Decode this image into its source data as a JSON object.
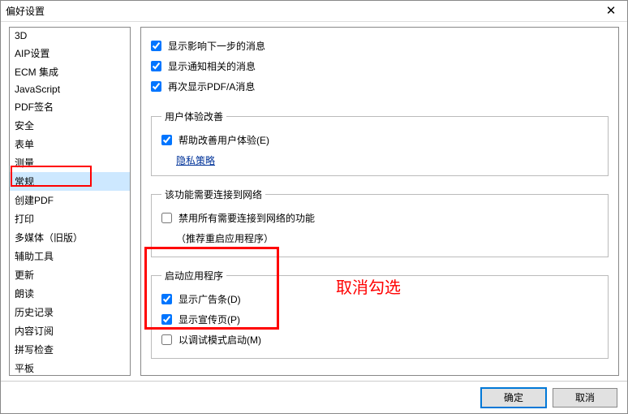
{
  "window": {
    "title": "偏好设置",
    "close_label": "✕"
  },
  "sidebar": {
    "items": [
      {
        "label": "3D"
      },
      {
        "label": "AIP设置"
      },
      {
        "label": "ECM 集成"
      },
      {
        "label": "JavaScript"
      },
      {
        "label": "PDF签名"
      },
      {
        "label": "安全"
      },
      {
        "label": "表单"
      },
      {
        "label": "测量"
      },
      {
        "label": "常规"
      },
      {
        "label": "创建PDF"
      },
      {
        "label": "打印"
      },
      {
        "label": "多媒体（旧版）"
      },
      {
        "label": "辅助工具"
      },
      {
        "label": "更新"
      },
      {
        "label": "朗读"
      },
      {
        "label": "历史记录"
      },
      {
        "label": "内容订阅"
      },
      {
        "label": "拼写检查"
      },
      {
        "label": "平板"
      }
    ],
    "selected_index": 8
  },
  "top_checks": {
    "show_next_step": "显示影响下一步的消息",
    "show_notification_related": "显示通知相关的消息",
    "show_pdfa_again": "再次显示PDF/A消息"
  },
  "ux_group": {
    "legend": "用户体验改善",
    "help_improve": "帮助改善用户体验(E)",
    "privacy_link": "隐私策略"
  },
  "network_group": {
    "legend": "该功能需要连接到网络",
    "disable_network": "禁用所有需要连接到网络的功能",
    "restart_hint": "（推荐重启应用程序）"
  },
  "launch_group": {
    "legend": "启动应用程序",
    "show_ad_bar": "显示广告条(D)",
    "show_promo_page": "显示宣传页(P)",
    "debug_mode": "以调试模式启动(M)"
  },
  "annotation": {
    "cancel_check": "取消勾选"
  },
  "buttons": {
    "ok": "确定",
    "cancel": "取消"
  }
}
